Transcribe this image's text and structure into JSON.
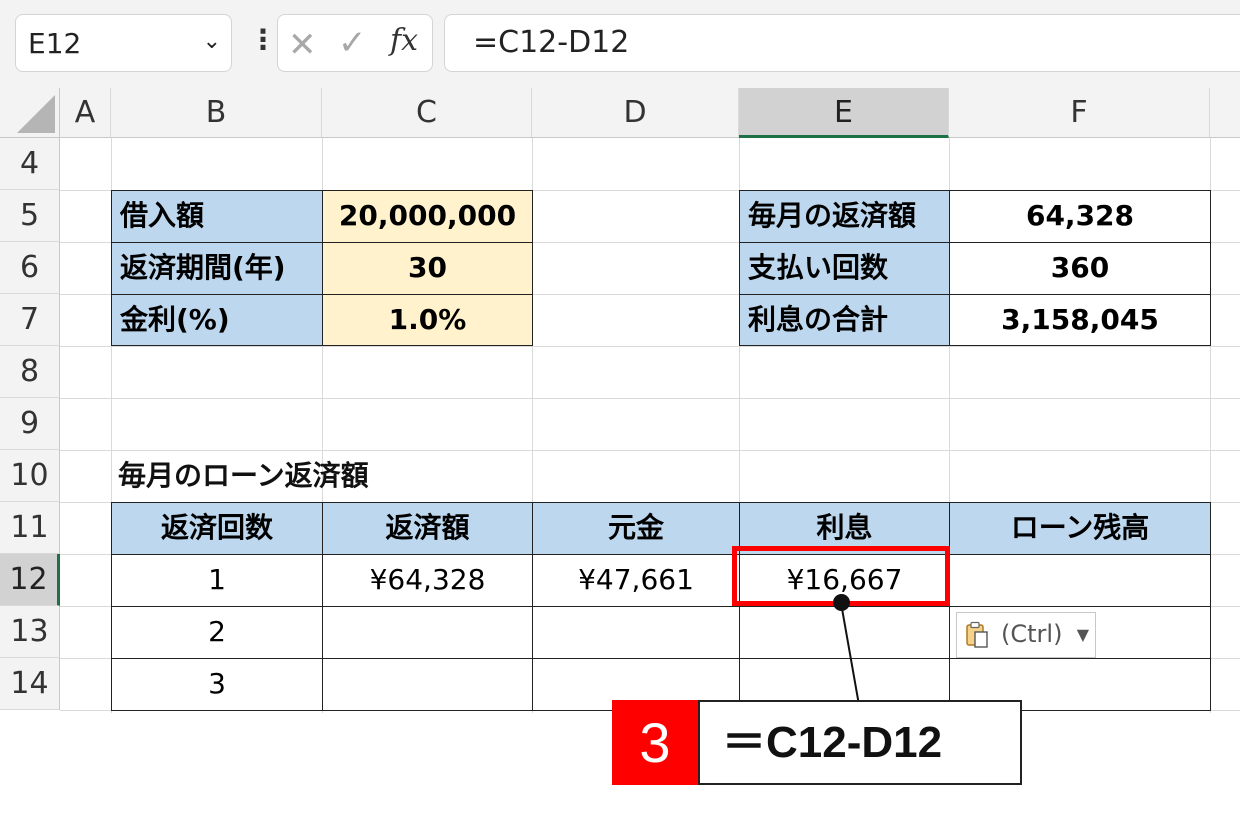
{
  "formula_bar": {
    "name_box": "E12",
    "cancel_glyph": "✕",
    "enter_glyph": "✓",
    "fx_label": "fx",
    "formula": "=C12-D12"
  },
  "columns": [
    "A",
    "B",
    "C",
    "D",
    "E",
    "F"
  ],
  "selected_column": "E",
  "rows": [
    "4",
    "5",
    "6",
    "7",
    "8",
    "9",
    "10",
    "11",
    "12",
    "13",
    "14"
  ],
  "selected_row": "12",
  "inputs": {
    "loan_label": "借入額",
    "loan_value": "20,000,000",
    "period_label": "返済期間(年)",
    "period_value": "30",
    "rate_label": "金利(%)",
    "rate_value": "1.0%"
  },
  "results": {
    "monthly_label": "毎月の返済額",
    "monthly_value": "64,328",
    "count_label": "支払い回数",
    "count_value": "360",
    "interest_label": "利息の合計",
    "interest_value": "3,158,045"
  },
  "schedule": {
    "title": "毎月のローン返済額",
    "headers": [
      "返済回数",
      "返済額",
      "元金",
      "利息",
      "ローン残高"
    ],
    "rows": [
      [
        "1",
        "¥64,328",
        "¥47,661",
        "¥16,667",
        ""
      ],
      [
        "2",
        "",
        "",
        "",
        ""
      ],
      [
        "3",
        "",
        "",
        "",
        ""
      ]
    ]
  },
  "paste_options": {
    "label": "(Ctrl)",
    "icon": "clipboard-icon"
  },
  "annotation": {
    "step": "3",
    "formula": "＝C12-D12",
    "highlight_color": "#ff0000"
  },
  "colors": {
    "header_blue": "#bdd7ee",
    "input_yellow": "#fff2cc",
    "excel_green": "#1e7145"
  }
}
